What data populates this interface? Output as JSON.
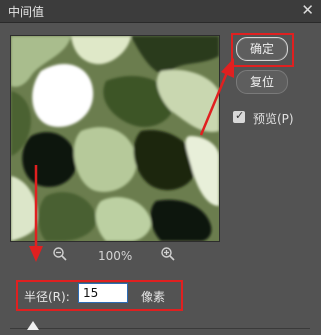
{
  "window": {
    "title": "中间值"
  },
  "preview": {
    "zoom": "100%"
  },
  "buttons": {
    "ok": "确定",
    "reset": "复位"
  },
  "preview_toggle": {
    "label": "预览(P)",
    "checked": true
  },
  "radius": {
    "label": "半径(R):",
    "value": "15",
    "unit": "像素"
  },
  "accent_color": "#e02020"
}
